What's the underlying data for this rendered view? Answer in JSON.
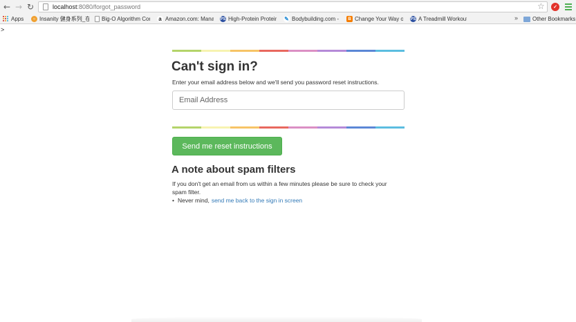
{
  "browser": {
    "url_host": "localhost",
    "url_path": ":8080/forgot_password",
    "bookmarks": [
      {
        "label": "Apps",
        "icon": "apps-grid-icon"
      },
      {
        "label": "Insanity 健身系列_在...",
        "icon": "orange-globe-icon",
        "color": "#f0a030"
      },
      {
        "label": "Big-O Algorithm Com...",
        "icon": "page-icon",
        "color": "#9a9a9a"
      },
      {
        "label": "Amazon.com: Manag...",
        "icon": "amazon-icon",
        "color": "#222222"
      },
      {
        "label": "High-Protein Protein...",
        "icon": "ps-icon",
        "color": "#2a4fa0"
      },
      {
        "label": "Bodybuilding.com - ...",
        "icon": "bodybuilding-icon",
        "color": "#2b8fd6"
      },
      {
        "label": "Change Your Way of...",
        "icon": "blogger-icon",
        "color": "#f57d00"
      },
      {
        "label": "A Treadmill Workout...",
        "icon": "ps-icon",
        "color": "#2a4fa0"
      }
    ],
    "more": "»",
    "other_bookmarks": "Other Bookmarks"
  },
  "page": {
    "caret": ">",
    "title": "Can't sign in?",
    "intro": "Enter your email address below and we'll send you password reset instructions.",
    "email_placeholder": "Email Address",
    "reset_button": "Send me reset instructions",
    "note_title": "A note about spam filters",
    "note_text": "If you don't get an email from us within a few minutes please be sure to check your spam filter.",
    "never_mind": "Never mind,",
    "back_link": "send me back to the sign in screen"
  },
  "colors": {
    "stripe": [
      "#b4d46a",
      "#f7f3b0",
      "#f7c466",
      "#e8685e",
      "#db8fc4",
      "#b58ad8",
      "#5b87d6",
      "#5bbde0"
    ],
    "button": "#5cb85c",
    "link": "#337ab7"
  }
}
